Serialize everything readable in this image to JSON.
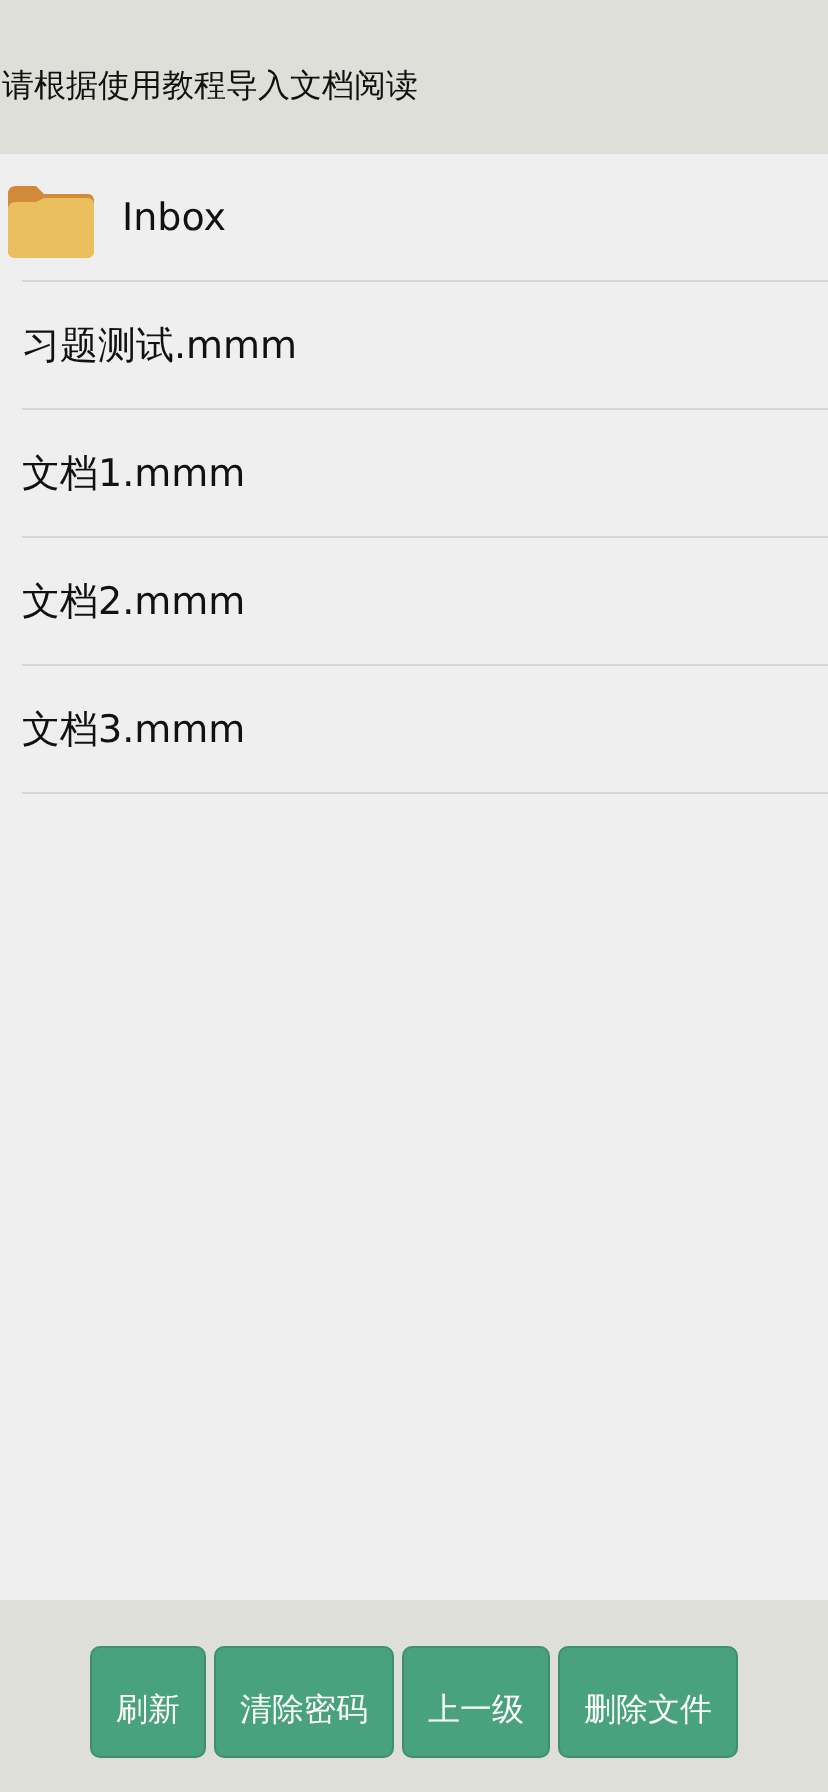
{
  "header": {
    "title": "请根据使用教程导入文档阅读"
  },
  "items": [
    {
      "kind": "folder",
      "name": "Inbox"
    },
    {
      "kind": "file",
      "name": "习题测试.mmm"
    },
    {
      "kind": "file",
      "name": "文档1.mmm"
    },
    {
      "kind": "file",
      "name": "文档2.mmm"
    },
    {
      "kind": "file",
      "name": "文档3.mmm"
    }
  ],
  "buttons": [
    "刷新",
    "清除密码",
    "上一级",
    "删除文件"
  ]
}
